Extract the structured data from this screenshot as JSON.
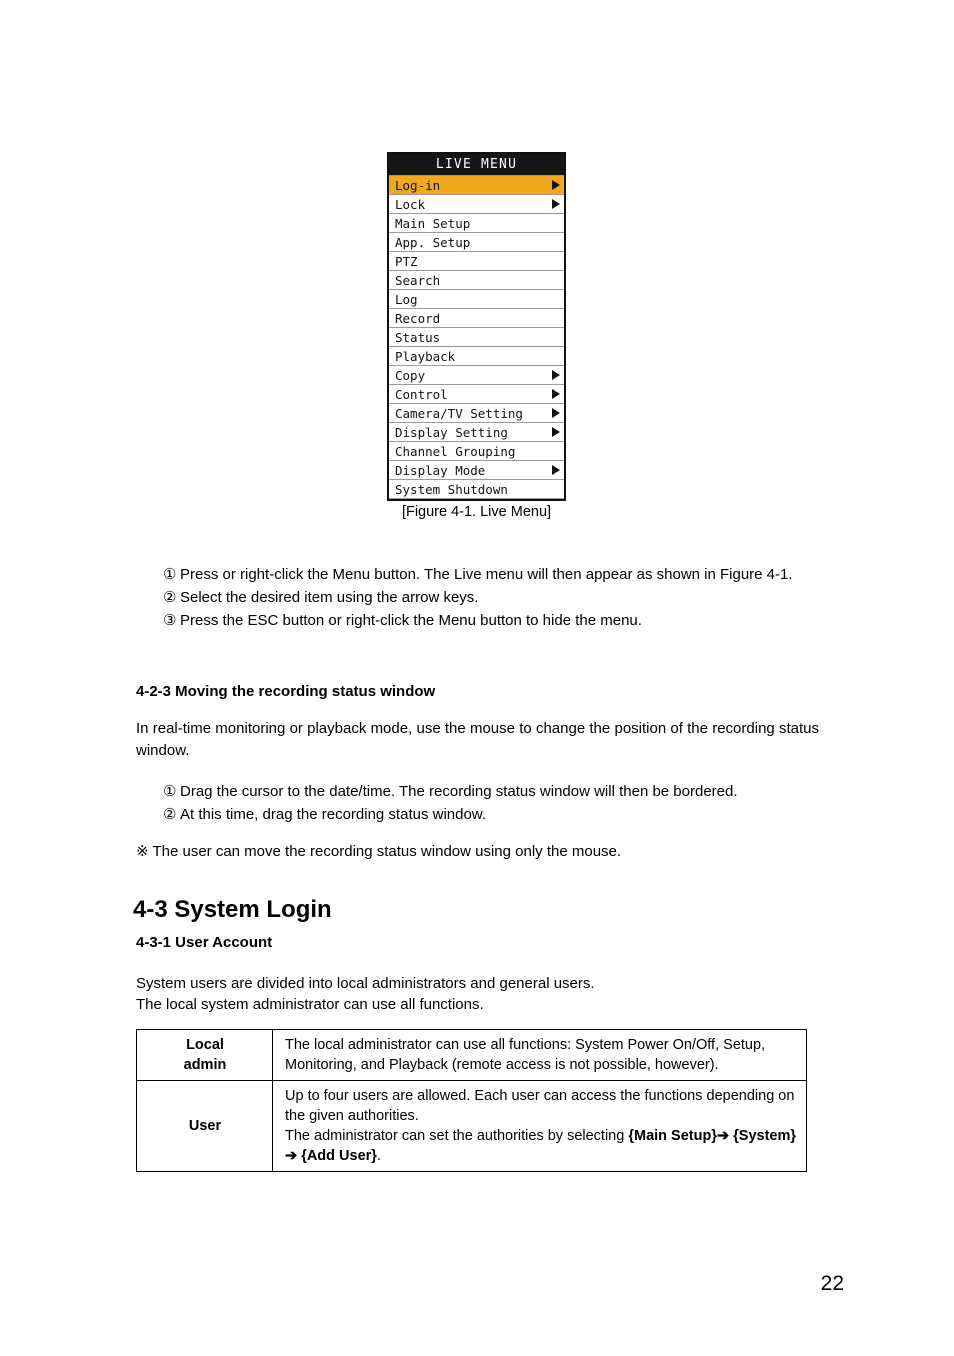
{
  "figure": {
    "menu_title": "LIVE MENU",
    "caption": "[Figure 4-1. Live Menu]",
    "highlight_color": "#F2A81C",
    "title_bg_color": "#161616",
    "items": [
      {
        "label": "Log-in",
        "arrow": true,
        "selected": true
      },
      {
        "label": "Lock",
        "arrow": true,
        "selected": false
      },
      {
        "label": "Main Setup",
        "arrow": false,
        "selected": false
      },
      {
        "label": "App. Setup",
        "arrow": false,
        "selected": false
      },
      {
        "label": "PTZ",
        "arrow": false,
        "selected": false
      },
      {
        "label": "Search",
        "arrow": false,
        "selected": false
      },
      {
        "label": "Log",
        "arrow": false,
        "selected": false
      },
      {
        "label": "Record",
        "arrow": false,
        "selected": false
      },
      {
        "label": "Status",
        "arrow": false,
        "selected": false
      },
      {
        "label": "Playback",
        "arrow": false,
        "selected": false
      },
      {
        "label": "Copy",
        "arrow": true,
        "selected": false
      },
      {
        "label": "Control",
        "arrow": true,
        "selected": false
      },
      {
        "label": "Camera/TV Setting",
        "arrow": true,
        "selected": false
      },
      {
        "label": "Display Setting",
        "arrow": true,
        "selected": false
      },
      {
        "label": "Channel Grouping",
        "arrow": false,
        "selected": false
      },
      {
        "label": "Display Mode",
        "arrow": true,
        "selected": false
      },
      {
        "label": "System Shutdown",
        "arrow": false,
        "selected": false
      }
    ]
  },
  "menu_steps": [
    {
      "mark": "①",
      "text": "Press or right-click the Menu button. The Live menu will then appear as shown in Figure 4-1."
    },
    {
      "mark": "②",
      "text": "Select the desired item using the arrow keys."
    },
    {
      "mark": "③",
      "text": "Press the ESC button or right-click the Menu button to hide the menu."
    }
  ],
  "section_423": {
    "heading": "4-2-3  Moving the recording status window",
    "paragraph": "In real-time monitoring or playback mode, use the mouse to change the position of the recording status window.",
    "steps": [
      {
        "mark": "①",
        "text": "Drag the cursor to the date/time. The recording status window will then be bordered."
      },
      {
        "mark": "②",
        "text": "At this time, drag the recording status window."
      }
    ],
    "note": "※ The user can move the recording status window using only the mouse."
  },
  "section_43": {
    "heading": "4-3  System Login",
    "sub_heading": "4-3-1  User Account",
    "intro_line1": "System users are divided into local administrators and general users.",
    "intro_line2": "The local system administrator can use all functions."
  },
  "account_table": {
    "rows": [
      {
        "label": "Local\nadmin",
        "description": "The local administrator can use all functions: System Power On/Off, Setup, Monitoring, and Playback (remote access is not possible, however)."
      },
      {
        "label": "User",
        "desc_line1": "Up to four users are allowed. Each user can access the functions depending on the given authorities.",
        "desc_line2_pre": "The administrator can set the authorities by selecting ",
        "desc_bold1": "{Main Setup}",
        "arrow1": "➔",
        "desc_bold2": "{System}",
        "arrow2": "➔",
        "desc_bold3": "{Add User}",
        "desc_tail": "."
      }
    ]
  },
  "page_number": "22"
}
